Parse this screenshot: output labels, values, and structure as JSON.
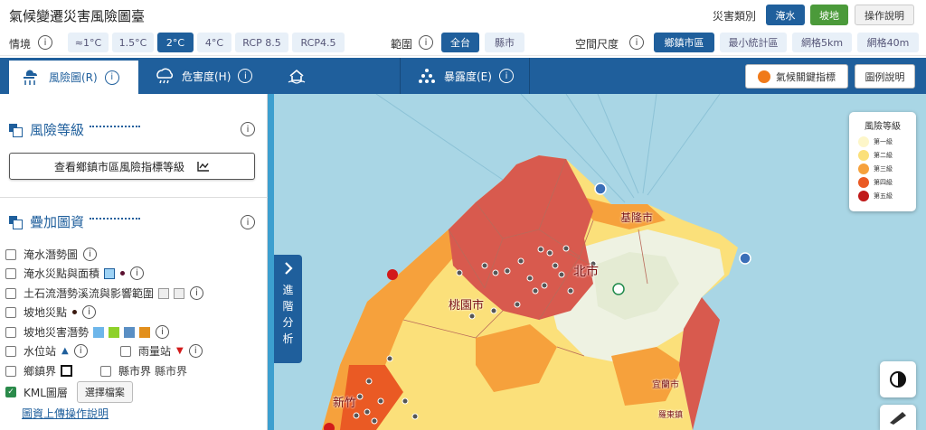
{
  "header": {
    "title": "氣候變遷災害風險圖臺",
    "hazard_label": "災害類別",
    "hazard_flood": "淹水",
    "hazard_slope": "坡地",
    "help": "操作說明"
  },
  "options": {
    "scenario_label": "情境",
    "scenarios": [
      "≈1°C",
      "1.5°C",
      "2°C",
      "4°C",
      "RCP 8.5",
      "RCP4.5"
    ],
    "scenario_selected": "2°C",
    "range_label": "範圍",
    "ranges": [
      "全台",
      "縣市"
    ],
    "range_selected": "全台",
    "scale_label": "空間尺度",
    "scales": [
      "鄉鎮市區",
      "最小統計區",
      "網格5km",
      "網格40m"
    ],
    "scale_selected": "鄉鎮市區"
  },
  "tabs": {
    "risk": "風險圖(R)",
    "hazard": "危害度(H)",
    "exposure": "暴露度(E)",
    "climate_index": "氣候關鍵指標",
    "legend_help": "圖例說明"
  },
  "panel": {
    "risk_level_title": "風險等級",
    "view_button": "查看鄉鎮市區風險指標等級",
    "overlay_title": "疊加圖資",
    "layers": {
      "flood_potential": "淹水潛勢圖",
      "flood_points": "淹水災點與面積",
      "debris_flow": "土石流潛勢溪流與影響範圍",
      "slope_points": "坡地災點",
      "slope_potential": "坡地災害潛勢",
      "water_station": "水位站",
      "rain_station": "雨量站",
      "township_boundary": "鄉鎮界",
      "county_boundary": "縣市界",
      "county_boundary_alt": "縣市界",
      "kml": "KML圖層",
      "choose_file": "選擇檔案"
    },
    "upload_link": "圖資上傳操作說明"
  },
  "map": {
    "side_tab": "進階分析",
    "legend_title": "風險等級",
    "legend_levels": [
      {
        "label": "第一級",
        "color": "#fdf6c9"
      },
      {
        "label": "第二級",
        "color": "#fbe07a"
      },
      {
        "label": "第三級",
        "color": "#f6a13c"
      },
      {
        "label": "第四級",
        "color": "#ea5a24"
      },
      {
        "label": "第五級",
        "color": "#c01a1a"
      }
    ],
    "place_labels": {
      "keelung": "基隆市",
      "taipei": "北市",
      "taoyuan": "桃園市",
      "hsinchu": "新竹",
      "yilan": "宜蘭市",
      "luodong": "羅東鎮"
    }
  }
}
